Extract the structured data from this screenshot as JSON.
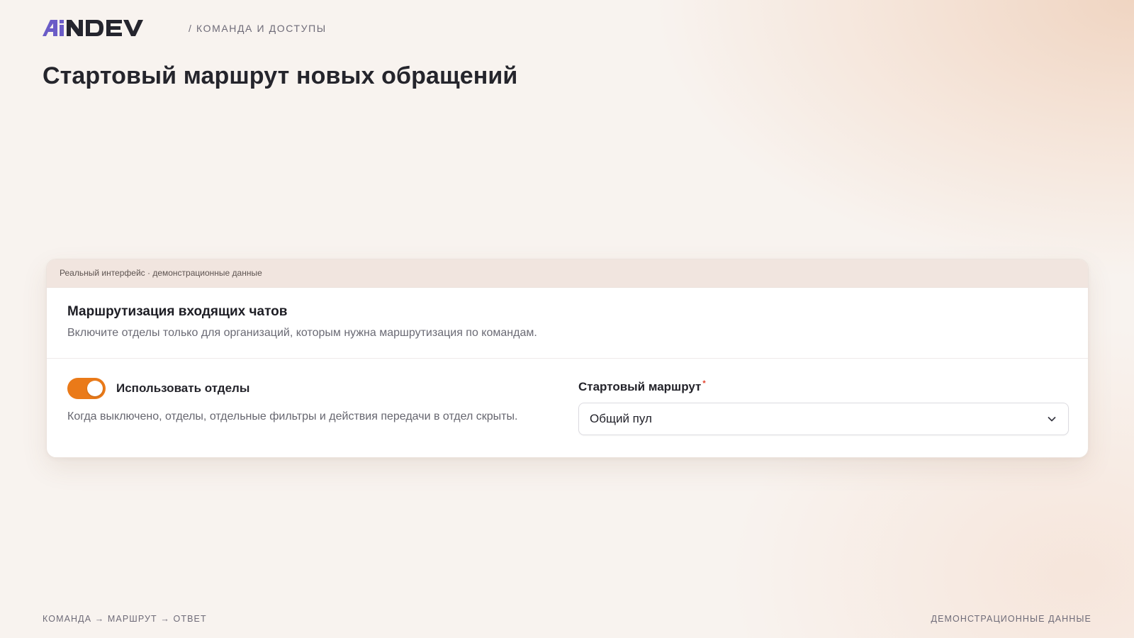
{
  "header": {
    "logo_text": "AiNDEV",
    "breadcrumb": "/ КОМАНДА И ДОСТУПЫ"
  },
  "page": {
    "title": "Стартовый маршрут новых обращений"
  },
  "card": {
    "caption": "Реальный интерфейс · демонстрационные данные",
    "section": {
      "title": "Маршрутизация входящих чатов",
      "description": "Включите отделы только для организаций, которым нужна маршрутизация по командам."
    },
    "departments_toggle": {
      "label": "Использовать отделы",
      "enabled": true,
      "hint": "Когда выключено, отделы, отдельные фильтры и действия передачи в отдел скрыты."
    },
    "start_route": {
      "label": "Стартовый маршрут",
      "required_mark": "*",
      "selected_value": "Общий пул"
    }
  },
  "footer": {
    "left": "КОМАНДА → МАРШРУТ → ОТВЕТ",
    "right": "ДЕМОНСТРАЦИОННЫЕ ДАННЫЕ"
  },
  "colors": {
    "accent": "#ea7a19",
    "logo_primary": "#25252e",
    "logo_accent": "#6b5cc7",
    "required": "#e0402b",
    "background": "#f8f3ef"
  },
  "icons": {
    "select_chevron": "chevron-down-icon"
  }
}
